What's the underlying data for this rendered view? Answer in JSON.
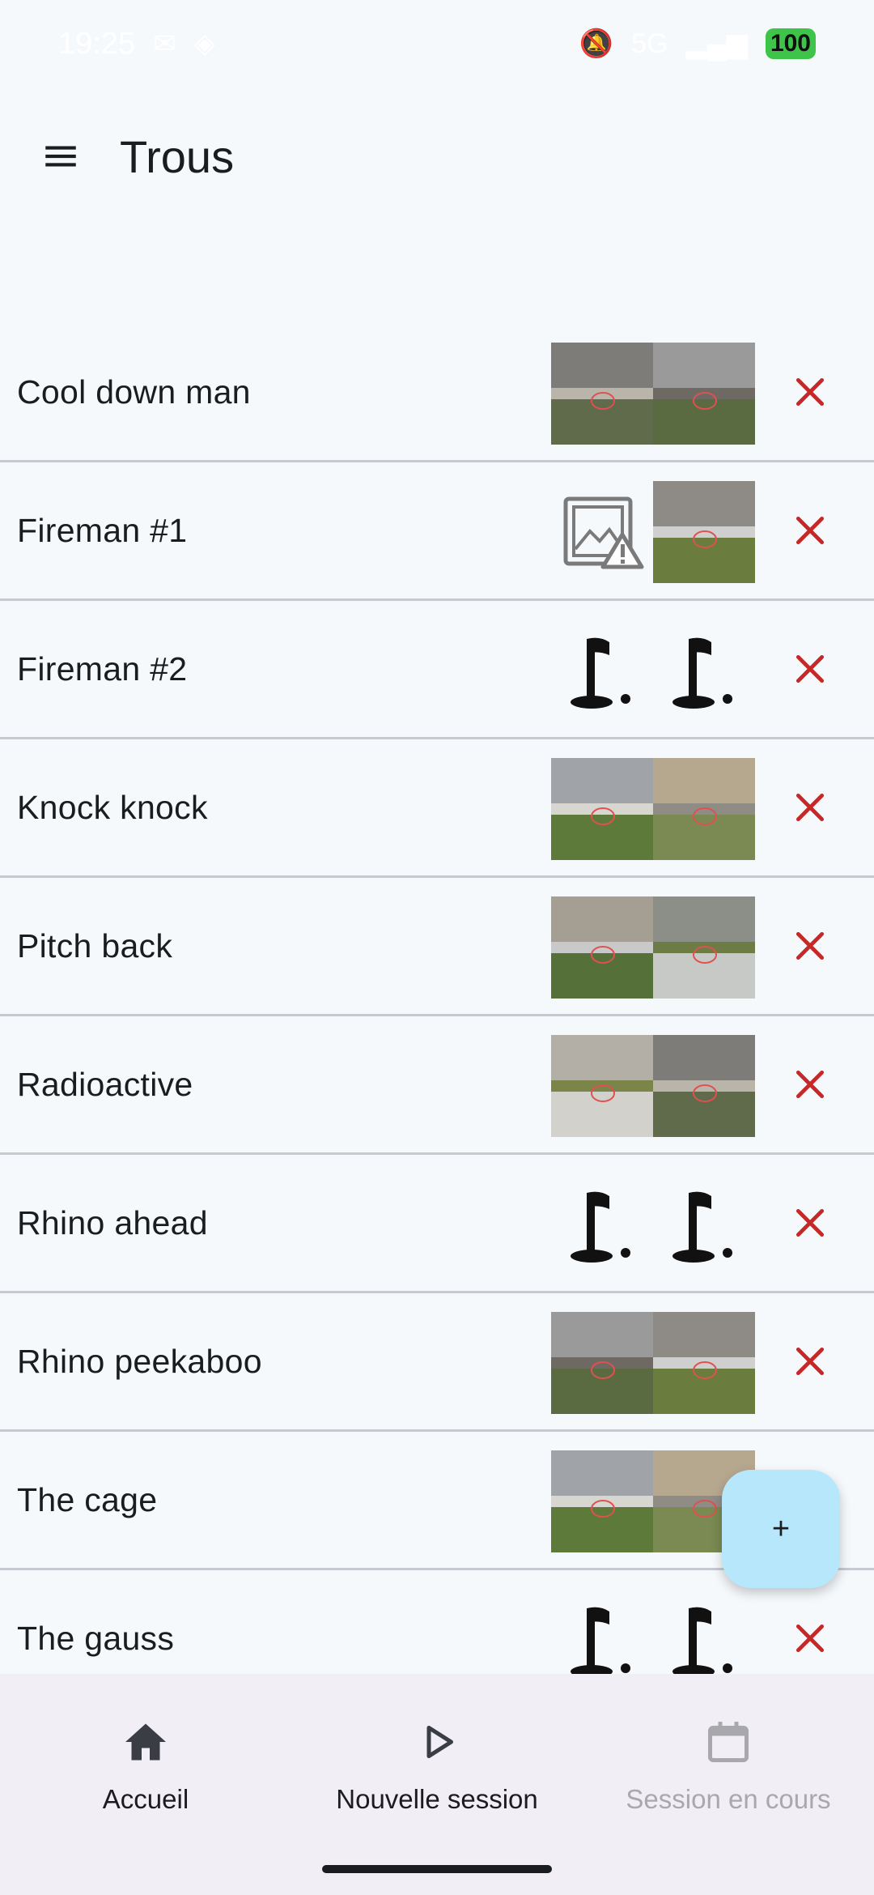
{
  "status_bar": {
    "time": "19:25",
    "network": "5G",
    "battery": "100"
  },
  "app_bar": {
    "title": "Trous"
  },
  "holes": [
    {
      "name": "Cool down man",
      "thumb1": "photo",
      "thumb2": "photo"
    },
    {
      "name": "Fireman #1",
      "thumb1": "broken-image",
      "thumb2": "photo"
    },
    {
      "name": "Fireman #2",
      "thumb1": "golf-flag",
      "thumb2": "golf-flag"
    },
    {
      "name": "Knock knock",
      "thumb1": "photo",
      "thumb2": "photo"
    },
    {
      "name": "Pitch back",
      "thumb1": "photo",
      "thumb2": "photo"
    },
    {
      "name": "Radioactive",
      "thumb1": "photo",
      "thumb2": "photo"
    },
    {
      "name": "Rhino ahead",
      "thumb1": "golf-flag",
      "thumb2": "golf-flag"
    },
    {
      "name": "Rhino peekaboo",
      "thumb1": "photo",
      "thumb2": "photo"
    },
    {
      "name": "The cage",
      "thumb1": "photo",
      "thumb2": "photo"
    },
    {
      "name": "The gauss",
      "thumb1": "golf-flag",
      "thumb2": "golf-flag"
    }
  ],
  "fab": {
    "label": "+"
  },
  "bottom_nav": {
    "items": [
      {
        "label": "Accueil",
        "icon": "home-icon",
        "enabled": true
      },
      {
        "label": "Nouvelle session",
        "icon": "play-icon",
        "enabled": true
      },
      {
        "label": "Session en cours",
        "icon": "calendar-icon",
        "enabled": false
      }
    ]
  },
  "colors": {
    "delete": "#c62828",
    "fab": "#b7e7fb",
    "nav_background": "#f1eef5",
    "background": "#f6f9fc"
  }
}
